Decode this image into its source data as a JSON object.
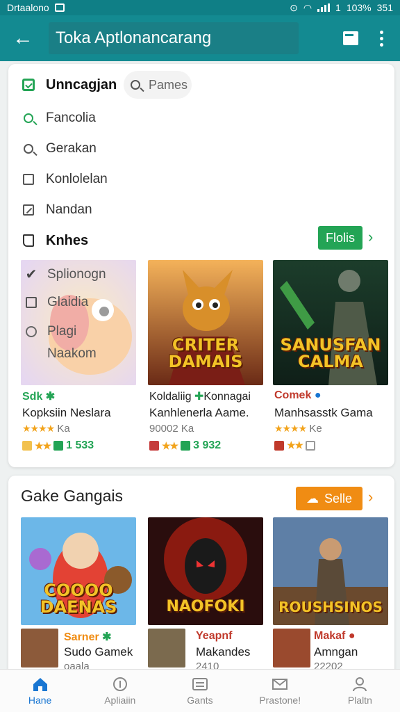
{
  "status_bar": {
    "carrier": "Drtaalono",
    "time": "351",
    "battery": "103%",
    "extras": "1"
  },
  "app_bar": {
    "title": "Toka Aptlonancarang"
  },
  "menu": {
    "items": [
      {
        "label": "Unncagjan",
        "icon": "check-square-icon"
      },
      {
        "label": "Fancolia",
        "icon": "search-icon"
      },
      {
        "label": "Gerakan",
        "icon": "search-icon"
      },
      {
        "label": "Konlolelan",
        "icon": "square-icon"
      },
      {
        "label": "Nandan",
        "icon": "edit-icon"
      },
      {
        "label": "Knhes",
        "icon": "book-icon"
      }
    ],
    "search_placeholder": "Pames",
    "action_button": "Flolis",
    "overlay_items": [
      "Splionogn",
      "Glaidia",
      "Plagi",
      "Naakom"
    ]
  },
  "section1": {
    "games": [
      {
        "tag": "Sdk",
        "name": "Kopksiin Neslara",
        "meta": "Ka",
        "rating": "1 533",
        "art_title": ""
      },
      {
        "tag": "Koldaliig",
        "tag2": "Konnagai",
        "name": "Kanhlenerla Aame.",
        "meta": "90002 Ka",
        "rating": "3 932",
        "art_title": "CRITER DAMAIS"
      },
      {
        "tag": "Comek",
        "name": "Manhsasstk Gama",
        "meta": "Ke",
        "rating": "",
        "art_title": "SANUSFAN CALMA"
      }
    ]
  },
  "section2": {
    "title": "Gake Gangais",
    "button": "Selle",
    "games": [
      {
        "art_title": "COOOO DAENAS",
        "tag": "Sarner",
        "name": "Sudo Gamek",
        "meta": "oaala"
      },
      {
        "art_title": "NAOFOKI",
        "tag": "Yeapnf",
        "name": "Makandes",
        "meta": "2410"
      },
      {
        "art_title": "ROUSHSINOS",
        "tag": "Makaf",
        "name": "Amngan",
        "meta": "22202"
      }
    ]
  },
  "bottom_nav": {
    "items": [
      {
        "label": "Hane",
        "active": true
      },
      {
        "label": "Apliaiin",
        "active": false
      },
      {
        "label": "Gants",
        "active": false
      },
      {
        "label": "Prastone!",
        "active": false
      },
      {
        "label": "Plaltn",
        "active": false
      }
    ]
  },
  "colors": {
    "primary": "#138a91",
    "accent_green": "#23a455",
    "accent_orange": "#f08c13",
    "active_nav": "#1976d2"
  }
}
